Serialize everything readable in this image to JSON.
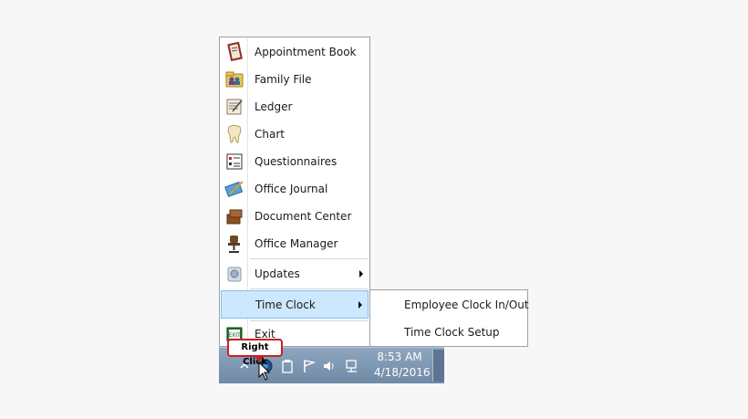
{
  "menu": {
    "items": [
      {
        "label": "Appointment Book",
        "icon": "appointment-book-icon"
      },
      {
        "label": "Family File",
        "icon": "family-file-icon"
      },
      {
        "label": "Ledger",
        "icon": "ledger-icon"
      },
      {
        "label": "Chart",
        "icon": "tooth-chart-icon"
      },
      {
        "label": "Questionnaires",
        "icon": "questionnaires-icon"
      },
      {
        "label": "Office Journal",
        "icon": "office-journal-icon"
      },
      {
        "label": "Document Center",
        "icon": "document-center-icon"
      },
      {
        "label": "Office Manager",
        "icon": "office-manager-icon"
      },
      {
        "label": "Updates",
        "icon": "updates-icon"
      },
      {
        "label": "Time Clock",
        "icon": ""
      },
      {
        "label": "Exit",
        "icon": "exit-icon"
      }
    ]
  },
  "submenu": {
    "items": [
      {
        "label": "Employee Clock In/Out"
      },
      {
        "label": "Time Clock Setup"
      }
    ]
  },
  "callout": {
    "text": "Right Click"
  },
  "taskbar": {
    "time": "8:53 AM",
    "date": "4/18/2016"
  },
  "colors": {
    "highlight": "#cce8ff",
    "highlight_border": "#7fbff0",
    "callout_border": "#cc1f1f",
    "taskbar": "#7f98b3"
  }
}
